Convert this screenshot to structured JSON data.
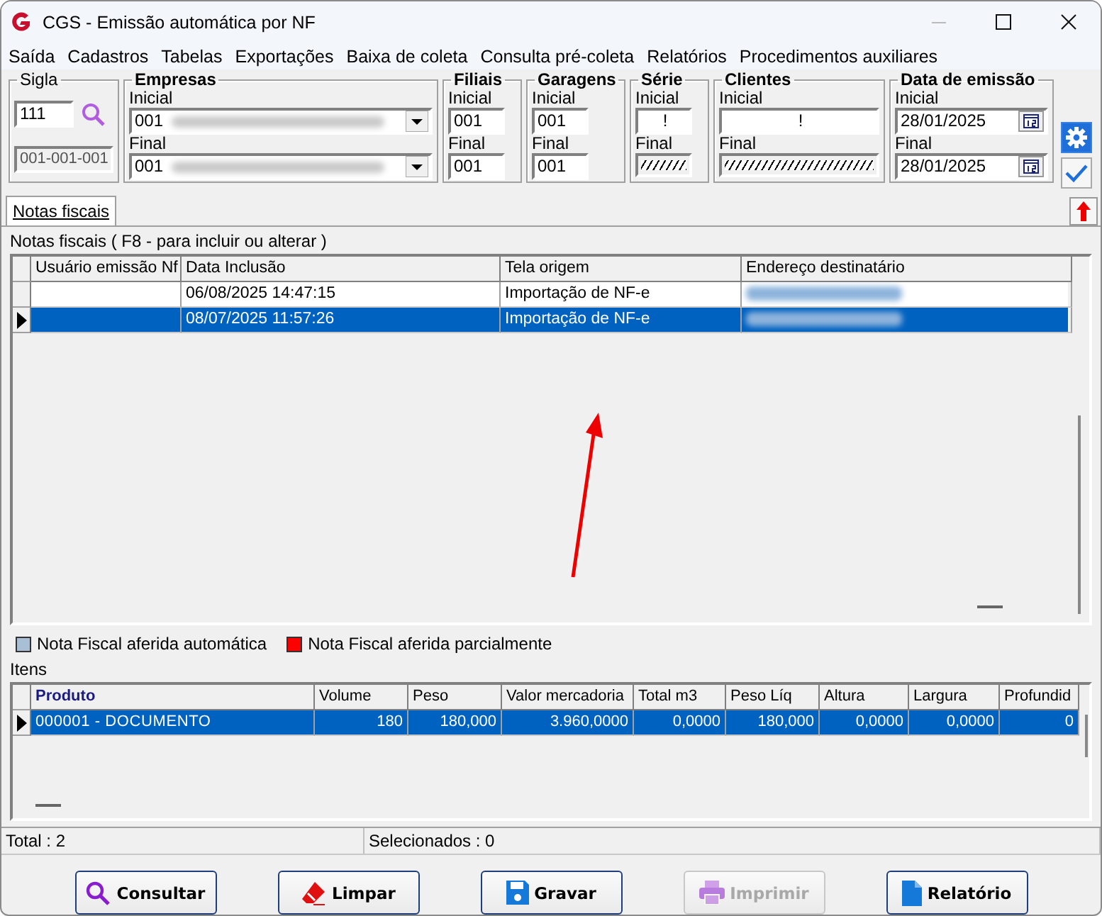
{
  "window": {
    "title": "CGS - Emissão automática por NF"
  },
  "menu": [
    "Saída",
    "Cadastros",
    "Tabelas",
    "Exportações",
    "Baixa de coleta",
    "Consulta pré-coleta",
    "Relatórios",
    "Procedimentos auxiliares"
  ],
  "sigla": {
    "label": "Sigla",
    "value": "111",
    "code": "001-001-001"
  },
  "filter_groups": [
    {
      "title": "Empresas",
      "rows": [
        {
          "label": "Inicial",
          "kind": "combo",
          "value": "001",
          "blurred": true
        },
        {
          "label": "Final",
          "kind": "combo",
          "value": "001",
          "blurred": true
        }
      ]
    },
    {
      "title": "Filiais",
      "rows": [
        {
          "label": "Inicial",
          "kind": "text",
          "value": "001"
        },
        {
          "label": "Final",
          "kind": "text",
          "value": "001"
        }
      ]
    },
    {
      "title": "Garagens",
      "rows": [
        {
          "label": "Inicial",
          "kind": "text",
          "value": "001"
        },
        {
          "label": "Final",
          "kind": "text",
          "value": "001"
        }
      ]
    },
    {
      "title": "Série",
      "rows": [
        {
          "label": "Inicial",
          "kind": "center",
          "value": "!"
        },
        {
          "label": "Final",
          "kind": "hatched"
        }
      ]
    },
    {
      "title": "Clientes",
      "rows": [
        {
          "label": "Inicial",
          "kind": "center",
          "value": "!"
        },
        {
          "label": "Final",
          "kind": "hatched"
        }
      ]
    },
    {
      "title": "Data de emissão",
      "rows": [
        {
          "label": "Inicial",
          "kind": "date",
          "value": "28/01/2025"
        },
        {
          "label": "Final",
          "kind": "date",
          "value": "28/01/2025"
        }
      ]
    }
  ],
  "tabs": [
    {
      "label": "Notas fiscais",
      "selected": true
    }
  ],
  "notes": {
    "caption": "Notas fiscais ( F8 - para incluir ou alterar )",
    "columns": [
      "Usuário emissão Nf",
      "Data Inclusão",
      "Tela origem",
      "Endereço destinatário"
    ],
    "rows": [
      {
        "selected": false,
        "cells": [
          null,
          "06/08/2025 14:47:15",
          "Importação de NF-e",
          null
        ],
        "address_blurred": true
      },
      {
        "selected": true,
        "cells": [
          null,
          "08/07/2025 11:57:26",
          "Importação de NF-e",
          null
        ],
        "address_blurred": true
      }
    ]
  },
  "legend": [
    {
      "label": "Nota Fiscal aferida automática",
      "color": "#a9bfd6"
    },
    {
      "label": "Nota Fiscal aferida parcialmente",
      "color": "#ff0000"
    }
  ],
  "items": {
    "caption": "Itens",
    "columns": [
      "Produto",
      "Volume",
      "Peso",
      "Valor mercadoria",
      "Total m3",
      "Peso Líq",
      "Altura",
      "Largura",
      "Profundid"
    ],
    "rows": [
      {
        "selected": true,
        "cells": [
          "000001 - DOCUMENTO",
          "180",
          "180,000",
          "3.960,0000",
          "0,0000",
          "180,000",
          "0,0000",
          "0,0000",
          "0"
        ]
      }
    ]
  },
  "status_bar": [
    "Total : 2",
    "Selecionados : 0"
  ],
  "buttons": [
    {
      "label": "Consultar",
      "disabled": false
    },
    {
      "label": "Limpar",
      "disabled": false
    },
    {
      "label": "Gravar",
      "disabled": false
    },
    {
      "label": "Imprimir",
      "disabled": true
    },
    {
      "label": "Relatório",
      "disabled": false
    }
  ]
}
